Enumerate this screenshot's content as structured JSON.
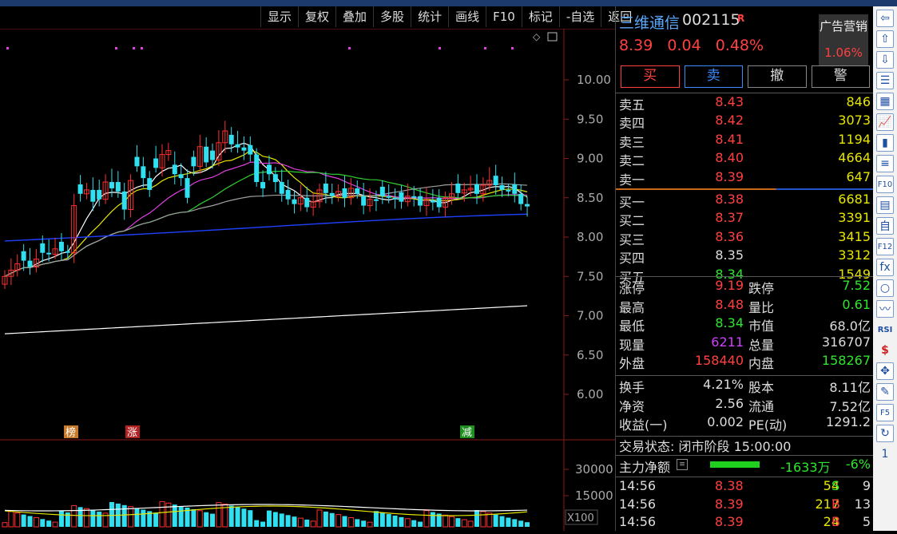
{
  "toolbar": [
    "显示",
    "复权",
    "叠加",
    "多股",
    "统计",
    "画线",
    "F10",
    "标记",
    "-自选",
    "返回"
  ],
  "chart": {
    "price_axis": [
      "10.00",
      "9.50",
      "9.00",
      "8.50",
      "8.00",
      "7.50",
      "7.00",
      "6.50",
      "6.00"
    ],
    "vol_axis": [
      "30000",
      "15000"
    ],
    "vol_unit": "X100",
    "markers": [
      {
        "text": "榜",
        "color": "#c87a2a"
      },
      {
        "text": "涨",
        "color": "#b22222"
      },
      {
        "text": "减",
        "color": "#1f8f1f"
      }
    ],
    "colors": {
      "up": "#ff3030",
      "down": "#30e0f0",
      "ma5": "#ffffff",
      "ma10": "#e6e600",
      "ma20": "#e040e0",
      "ma30": "#30d030",
      "ma60": "#a0a0a0",
      "ma120": "#2040ff",
      "ma250": "#ffffff"
    }
  },
  "stock": {
    "name": "三维通信",
    "code": "002115",
    "flag": "R",
    "price": "8.39",
    "change": "0.04",
    "pct": "0.48%"
  },
  "ad": {
    "title": "广告营销",
    "value": "1.06%"
  },
  "trade_buttons": [
    "买",
    "卖",
    "撤",
    "警"
  ],
  "asks": [
    {
      "label": "卖五",
      "price": "8.43",
      "vol": "846",
      "color": "red"
    },
    {
      "label": "卖四",
      "price": "8.42",
      "vol": "3073",
      "color": "red"
    },
    {
      "label": "卖三",
      "price": "8.41",
      "vol": "1194",
      "color": "red"
    },
    {
      "label": "卖二",
      "price": "8.40",
      "vol": "4664",
      "color": "red"
    },
    {
      "label": "卖一",
      "price": "8.39",
      "vol": "647",
      "color": "red"
    }
  ],
  "bids": [
    {
      "label": "买一",
      "price": "8.38",
      "vol": "6681",
      "color": "red"
    },
    {
      "label": "买二",
      "price": "8.37",
      "vol": "3391",
      "color": "red"
    },
    {
      "label": "买三",
      "price": "8.36",
      "vol": "3415",
      "color": "red"
    },
    {
      "label": "买四",
      "price": "8.35",
      "vol": "3312",
      "color": "white"
    },
    {
      "label": "买五",
      "price": "8.34",
      "vol": "1549",
      "color": "green"
    }
  ],
  "stats1": [
    {
      "l1": "涨停",
      "v1": "9.19",
      "c1": "red",
      "l2": "跌停",
      "v2": "7.52",
      "c2": "green"
    },
    {
      "l1": "最高",
      "v1": "8.48",
      "c1": "red",
      "l2": "量比",
      "v2": "0.61",
      "c2": "green"
    },
    {
      "l1": "最低",
      "v1": "8.34",
      "c1": "green",
      "l2": "市值",
      "v2": "68.0亿",
      "c2": "white"
    },
    {
      "l1": "现量",
      "v1": "6211",
      "c1": "purple",
      "l2": "总量",
      "v2": "316707",
      "c2": "white"
    },
    {
      "l1": "外盘",
      "v1": "158440",
      "c1": "red",
      "l2": "内盘",
      "v2": "158267",
      "c2": "green"
    }
  ],
  "stats2": [
    {
      "l1": "换手",
      "v1": "4.21%",
      "l2": "股本",
      "v2": "8.11亿"
    },
    {
      "l1": "净资",
      "v1": "2.56",
      "l2": "流通",
      "v2": "7.52亿"
    },
    {
      "l1": "收益(一)",
      "v1": "0.002",
      "l2": "PE(动)",
      "v2": "1291.2"
    }
  ],
  "status": "交易状态: 闭市阶段 15:00:00",
  "mainflow": {
    "label": "主力净额",
    "amount": "-1633万",
    "pct": "-6%"
  },
  "ticks": [
    {
      "time": "14:56",
      "price": "8.38",
      "vol": "54",
      "dir": "S",
      "n": "9",
      "pc": "red",
      "dc": "green"
    },
    {
      "time": "14:56",
      "price": "8.39",
      "vol": "217",
      "dir": "B",
      "n": "13",
      "pc": "red",
      "dc": "red"
    },
    {
      "time": "14:56",
      "price": "8.39",
      "vol": "24",
      "dir": "B",
      "n": "5",
      "pc": "red",
      "dc": "red"
    }
  ],
  "side_icons": [
    "arrow-left-icon",
    "arrow-up-icon",
    "arrow-down-icon",
    "list-icon",
    "grid-icon",
    "line-chart-icon",
    "candle-icon",
    "news-icon",
    "f10-icon",
    "report-icon",
    "self-icon",
    "f12-icon",
    "fx-icon",
    "circle-icon",
    "wave-icon",
    "rsi-icon",
    "dollar-icon",
    "move-icon",
    "pencil-icon",
    "f5-icon",
    "refresh-icon",
    "page-icon"
  ],
  "side_glyphs": [
    "⇦",
    "⇧",
    "⇩",
    "☰",
    "▦",
    "📈",
    "▮",
    "≡",
    "F10",
    "▤",
    "自",
    "F12",
    "fx",
    "○",
    "〰",
    "RSI",
    "$",
    "✥",
    "✎",
    "F5",
    "↻",
    "1"
  ]
}
